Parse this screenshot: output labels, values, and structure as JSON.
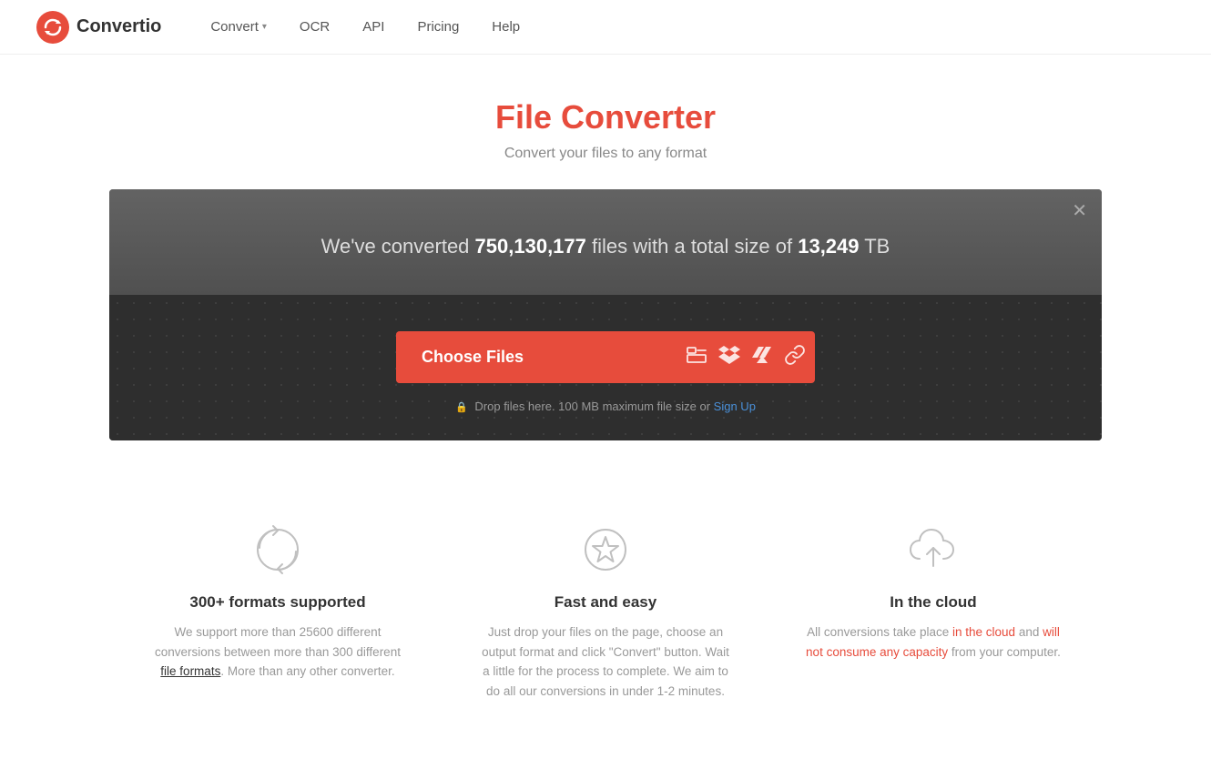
{
  "brand": {
    "name": "Convertio"
  },
  "nav": {
    "items": [
      {
        "label": "Convert",
        "has_dropdown": true
      },
      {
        "label": "OCR",
        "has_dropdown": false
      },
      {
        "label": "API",
        "has_dropdown": false
      },
      {
        "label": "Pricing",
        "has_dropdown": false
      },
      {
        "label": "Help",
        "has_dropdown": false
      }
    ]
  },
  "hero": {
    "title": "File Converter",
    "subtitle": "Convert your files to any format"
  },
  "converter": {
    "stats_prefix": "We've converted ",
    "stats_count": "750,130,177",
    "stats_middle": " files with a total size of ",
    "stats_size": "13,249",
    "stats_suffix": " TB",
    "choose_files_label": "Choose Files",
    "drop_hint_prefix": "Drop files here. 100 MB maximum file size or ",
    "drop_hint_link": "Sign Up"
  },
  "features": [
    {
      "icon": "refresh",
      "title": "300+ formats supported",
      "desc_parts": [
        {
          "text": "We support more than 25600 different conversions between more than 300 different ",
          "type": "normal"
        },
        {
          "text": "file formats",
          "type": "link"
        },
        {
          "text": ". More than any other converter.",
          "type": "normal"
        }
      ]
    },
    {
      "icon": "star",
      "title": "Fast and easy",
      "desc_parts": [
        {
          "text": "Just drop your files on the page, choose an output format and click \"Convert\" button. Wait a little for the process to complete. We aim to do all our conversions in under 1-2 minutes.",
          "type": "normal"
        }
      ]
    },
    {
      "icon": "cloud-upload",
      "title": "In the cloud",
      "desc_parts": [
        {
          "text": "All conversions take place ",
          "type": "normal"
        },
        {
          "text": "in the cloud",
          "type": "highlight"
        },
        {
          "text": " and ",
          "type": "normal"
        },
        {
          "text": "will not consume any capacity",
          "type": "highlight"
        },
        {
          "text": " from your computer.",
          "type": "normal"
        }
      ]
    }
  ]
}
